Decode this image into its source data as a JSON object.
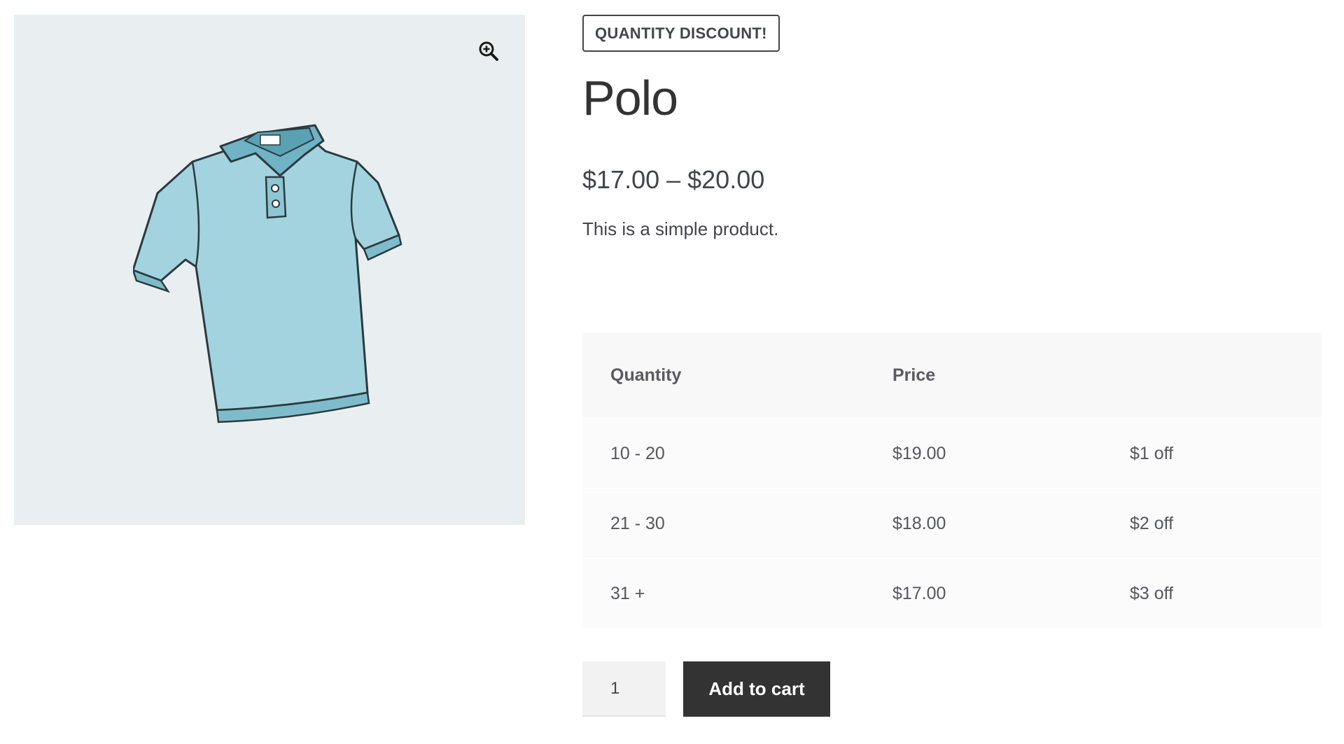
{
  "product": {
    "badge": "QUANTITY DISCOUNT!",
    "title": "Polo",
    "price_range": "$17.00 – $20.00",
    "description": "This is a simple product.",
    "image_icon": "polo-shirt",
    "zoom_icon": "zoom-in-icon"
  },
  "pricing_table": {
    "headers": [
      "Quantity",
      "Price",
      ""
    ],
    "rows": [
      {
        "quantity": "10 - 20",
        "price": "$19.00",
        "discount": "$1 off"
      },
      {
        "quantity": "21 - 30",
        "price": "$18.00",
        "discount": "$2 off"
      },
      {
        "quantity": "31 +",
        "price": "$17.00",
        "discount": "$3 off"
      }
    ]
  },
  "cart": {
    "quantity_value": "1",
    "add_to_cart_label": "Add to cart"
  },
  "colors": {
    "gallery_bg": "#e9eff1",
    "shirt": "#9fd0dc",
    "button_bg": "#333333",
    "text": "#43454b"
  }
}
